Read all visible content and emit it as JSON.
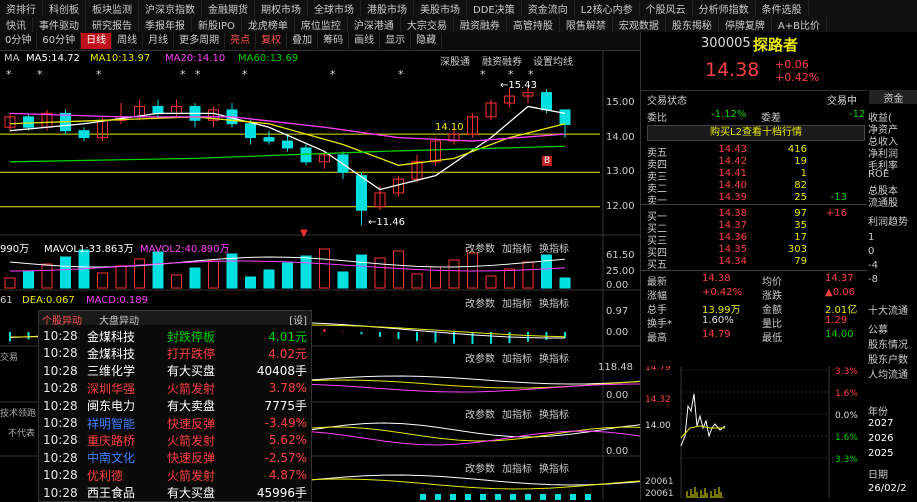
{
  "menu": {
    "row1": [
      "资排行",
      "科创板",
      "板块监测",
      "沪深京指数",
      "金融期货",
      "期权市场",
      "全球市场",
      "港股市场",
      "美股市场",
      "DDE决策",
      "资金流向",
      "L2核心内参",
      "个股风云",
      "分析师指数",
      "条件选股"
    ],
    "row2": [
      "快讯",
      "事件驱动",
      "研究报告",
      "季报年报",
      "新股IPO",
      "龙虎榜单",
      "席位监控",
      "沪深港通",
      "大宗交易",
      "融资融券",
      "高管持股",
      "限售解禁",
      "宏观数据",
      "股东揭秘",
      "停牌复牌",
      "A+B比价"
    ]
  },
  "toolbar": {
    "items": [
      "0分钟",
      "60分钟",
      "日线",
      "周线",
      "月线",
      "更多周期",
      "亮点",
      "复权",
      "叠加",
      "筹码",
      "画线",
      "显示",
      "隐藏"
    ],
    "active": "日线",
    "red_items": [
      "亮点",
      "复权"
    ]
  },
  "ma_legend": {
    "title": "MA",
    "ma5": "MA5:14.72",
    "ma10": "MA10:13.97",
    "ma20": "MA20:14.10",
    "ma60": "MA60:13.69",
    "deep_chart": "深股通",
    "margin_chart": "融资融券",
    "setting": "设置均线",
    "colors": {
      "ma5": "#ffffff",
      "ma10": "#e8e800",
      "ma20": "#ff40ff",
      "ma60": "#00d000"
    }
  },
  "price_axis": [
    "15.00",
    "14.00",
    "13.00",
    "12.00"
  ],
  "annotations": {
    "high": "15.43",
    "low": "11.46",
    "mid": "14.10",
    "b_mark": "B"
  },
  "vol_legend": {
    "text": "990万",
    "mavol1": "MAVOL1:33.863万",
    "mavol2": "MAVOL2:40.890万",
    "change": "改参数",
    "add": "加指标",
    "switch": "换指标",
    "axis": [
      "61.50",
      "25.00",
      "0.00"
    ]
  },
  "macd_legend": {
    "prefix": "61",
    "dea": "DEA:0.067",
    "macd": "MACD:0.189",
    "axis_top": "0.97",
    "axis_mid": "0.00",
    "change": "改参数",
    "add": "加指标",
    "switch": "换指标"
  },
  "lower_axes": [
    "118.48",
    "0.00",
    "0.00"
  ],
  "news": {
    "tab1": "个股异动",
    "tab2": "大盘异动",
    "setting": "[设]",
    "rows": [
      {
        "time": "10:28",
        "stock": "金煤科技",
        "event": "封跌停板",
        "value": "4.01元",
        "stock_color": "#ffffff",
        "event_color": "#00d000",
        "value_color": "#00d000"
      },
      {
        "time": "10:28",
        "stock": "金煤科技",
        "event": "打开跌停",
        "value": "4.02元",
        "stock_color": "#ffffff",
        "event_color": "#ff4040",
        "value_color": "#ff4040"
      },
      {
        "time": "10:28",
        "stock": "三维化学",
        "event": "有大买盘",
        "value": "40408手",
        "stock_color": "#ffffff",
        "event_color": "#ffffff",
        "value_color": "#ffffff"
      },
      {
        "time": "10:28",
        "stock": "深圳华强",
        "event": "火箭发射",
        "value": "3.78%",
        "stock_color": "#ff4040",
        "event_color": "#ff4040",
        "value_color": "#ff4040"
      },
      {
        "time": "10:28",
        "stock": "闽东电力",
        "event": "有大卖盘",
        "value": "7775手",
        "stock_color": "#ffffff",
        "event_color": "#ffffff",
        "value_color": "#ffffff"
      },
      {
        "time": "10:28",
        "stock": "祥明智能",
        "event": "快速反弹",
        "value": "-3.49%",
        "stock_color": "#4080ff",
        "event_color": "#ff4040",
        "value_color": "#ff4040"
      },
      {
        "time": "10:28",
        "stock": "重庆路桥",
        "event": "火箭发射",
        "value": "5.62%",
        "stock_color": "#ff4040",
        "event_color": "#ff4040",
        "value_color": "#ff4040"
      },
      {
        "time": "10:28",
        "stock": "中南文化",
        "event": "快速反弹",
        "value": "-2.57%",
        "stock_color": "#4080ff",
        "event_color": "#ff4040",
        "value_color": "#ff4040"
      },
      {
        "time": "10:28",
        "stock": "优利德",
        "event": "火箭发射",
        "value": "4.87%",
        "stock_color": "#ff4040",
        "event_color": "#ff4040",
        "value_color": "#ff4040"
      },
      {
        "time": "10:28",
        "stock": "西王食品",
        "event": "有大买盘",
        "value": "45996手",
        "stock_color": "#ffffff",
        "event_color": "#ffffff",
        "value_color": "#ffffff"
      }
    ]
  },
  "left_snips": [
    "交易",
    "技术领跑",
    "不代表"
  ],
  "quote": {
    "code": "300005",
    "name": "探路者",
    "price": "14.38",
    "change": "+0.06",
    "change_pct": "+0.42%",
    "status_label": "交易状态",
    "status": "交易中",
    "ratio_label": "委比",
    "ratio": "-1.12%",
    "diff_label": "委差",
    "diff": "-12",
    "l2_button": "购买L2查看十档行情",
    "asks": [
      {
        "n": "卖五",
        "p": "14.43",
        "v": "416",
        "d": ""
      },
      {
        "n": "卖四",
        "p": "14.42",
        "v": "19",
        "d": ""
      },
      {
        "n": "卖三",
        "p": "14.41",
        "v": "1",
        "d": ""
      },
      {
        "n": "卖二",
        "p": "14.40",
        "v": "82",
        "d": ""
      },
      {
        "n": "卖一",
        "p": "14.39",
        "v": "25",
        "d": "-13"
      }
    ],
    "bids": [
      {
        "n": "买一",
        "p": "14.38",
        "v": "97",
        "d": "+16"
      },
      {
        "n": "买二",
        "p": "14.37",
        "v": "35",
        "d": ""
      },
      {
        "n": "买三",
        "p": "14.36",
        "v": "17",
        "d": ""
      },
      {
        "n": "买四",
        "p": "14.35",
        "v": "303",
        "d": ""
      },
      {
        "n": "买五",
        "p": "14.34",
        "v": "79",
        "d": ""
      }
    ],
    "stats": [
      {
        "l1": "最新",
        "v1": "14.38",
        "l2": "均价",
        "v2": "14.37"
      },
      {
        "l1": "涨幅",
        "v1": "+0.42%",
        "l2": "涨跌",
        "v2": "▲0.06"
      },
      {
        "l1": "总手",
        "v1": "13.99万",
        "l2": "金额",
        "v2": "2.01亿"
      },
      {
        "l1": "换手*",
        "v1": "1.60%",
        "l2": "量比",
        "v2": "1.29"
      },
      {
        "l1": "最高",
        "v1": "14.79",
        "l2": "最低",
        "v2": "14.00"
      }
    ],
    "mini_axis_left": [
      "14.79",
      "14.32",
      "14.00",
      "20061",
      "20061"
    ],
    "mini_axis_right": [
      "3.3%",
      "1.6%",
      "0.0%",
      "1.6%",
      "3.3%"
    ]
  },
  "side_panel": {
    "tab": "资金",
    "items": [
      "收益(",
      "净资产",
      "总收入",
      "净利润",
      "毛利率",
      "ROE",
      "总股本",
      "流通股"
    ],
    "trend": "利润趋势",
    "trend_axis": [
      "1",
      "0",
      "-4",
      "-8"
    ],
    "holders": "十大流通",
    "holder_items": [
      "公募",
      "股东情况",
      "股东户数",
      "人均流通"
    ],
    "year_label": "年份",
    "years": [
      "2027",
      "2026",
      "2025"
    ],
    "date_label": "日期",
    "date": "26/02/2"
  }
}
